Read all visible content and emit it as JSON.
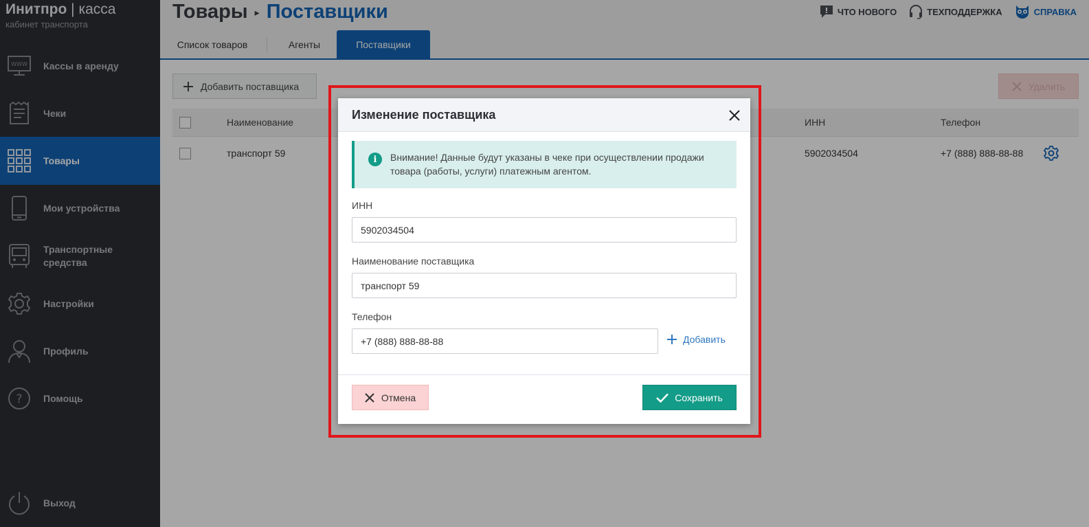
{
  "app": {
    "logo_brand": "Инитпро",
    "logo_divider": "|",
    "logo_product": "касса",
    "logo_subtitle": "кабинет транспорта"
  },
  "sidebar": {
    "items": [
      {
        "label": "Кассы в аренду",
        "icon": "monitor-www-icon",
        "active": false
      },
      {
        "label": "Чеки",
        "icon": "receipt-icon",
        "active": false
      },
      {
        "label": "Товары",
        "icon": "grid-icon",
        "active": true
      },
      {
        "label": "Мои устройства",
        "icon": "smartphone-icon",
        "active": false
      },
      {
        "label": "Транспортные средства",
        "icon": "bus-icon",
        "active": false
      },
      {
        "label": "Настройки",
        "icon": "gear-icon",
        "active": false
      },
      {
        "label": "Профиль",
        "icon": "user-icon",
        "active": false
      },
      {
        "label": "Помощь",
        "icon": "question-icon",
        "active": false
      }
    ],
    "logout_label": "Выход"
  },
  "header": {
    "breadcrumb_root": "Товары",
    "breadcrumb_current": "Поставщики",
    "topnav": {
      "whats_new": "ЧТО НОВОГО",
      "support": "ТЕХПОДДЕРЖКА",
      "help": "СПРАВКА"
    }
  },
  "tabs": {
    "goods_list": "Список товаров",
    "agents": "Агенты",
    "suppliers": "Поставщики"
  },
  "toolbar": {
    "add_supplier": "Добавить поставщика",
    "delete": "Удалить"
  },
  "table": {
    "columns": {
      "name": "Наименование",
      "inn": "ИНН",
      "phone": "Телефон"
    },
    "rows": [
      {
        "name": "транспорт 59",
        "inn": "5902034504",
        "phone": "+7 (888) 888-88-88"
      }
    ]
  },
  "modal": {
    "title": "Изменение поставщика",
    "notice": "Внимание! Данные будут указаны в чеке при осуществлении продажи товара (работы, услуги) платежным агентом.",
    "inn_label": "ИНН",
    "inn_value": "5902034504",
    "name_label": "Наименование поставщика",
    "name_value": "транспорт 59",
    "phone_label": "Телефон",
    "phone_value": "+7 (888) 888-88-88",
    "add_phone": "Добавить",
    "cancel": "Отмена",
    "save": "Сохранить"
  },
  "colors": {
    "sidebar_bg": "#2b2e35",
    "accent_blue": "#1565b5",
    "teal": "#139c88",
    "highlight_red": "#e0161b"
  }
}
